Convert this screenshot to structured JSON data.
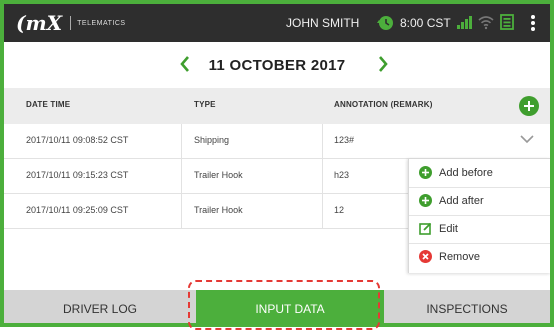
{
  "topbar": {
    "logo_mark": "(mX",
    "logo_text": "TELEMATICS",
    "user_name": "JOHN SMITH",
    "time": "8:00 CST",
    "icons": [
      "clock-history-icon",
      "signal-icon",
      "wifi-icon",
      "document-icon",
      "more-vertical-icon"
    ]
  },
  "date_nav": {
    "date": "11 OCTOBER 2017",
    "prev_icon": "chevron-left-icon",
    "next_icon": "chevron-right-icon"
  },
  "table": {
    "headers": {
      "datetime": "DATE TIME",
      "type": "TYPE",
      "annotation": "ANNOTATION (REMARK)"
    },
    "rows": [
      {
        "datetime": "2017/10/11 09:08:52 CST",
        "type": "Shipping",
        "annotation": "123#"
      },
      {
        "datetime": "2017/10/11 09:15:23 CST",
        "type": "Trailer Hook",
        "annotation": "h23"
      },
      {
        "datetime": "2017/10/11 09:25:09 CST",
        "type": "Trailer Hook",
        "annotation": "12"
      }
    ]
  },
  "context_menu": {
    "items": [
      {
        "label": "Add before",
        "icon": "plus-circle-icon"
      },
      {
        "label": "Add after",
        "icon": "plus-circle-icon"
      },
      {
        "label": "Edit",
        "icon": "edit-icon"
      },
      {
        "label": "Remove",
        "icon": "remove-circle-icon"
      }
    ]
  },
  "tabs": {
    "driver_log": "DRIVER LOG",
    "input_data": "INPUT DATA",
    "inspections": "INSPECTIONS",
    "active": "INPUT DATA"
  },
  "colors": {
    "accent_green": "#4caf3c",
    "topbar": "#2e2e2e",
    "highlight_red": "#e53935",
    "remove_red": "#e53935"
  }
}
